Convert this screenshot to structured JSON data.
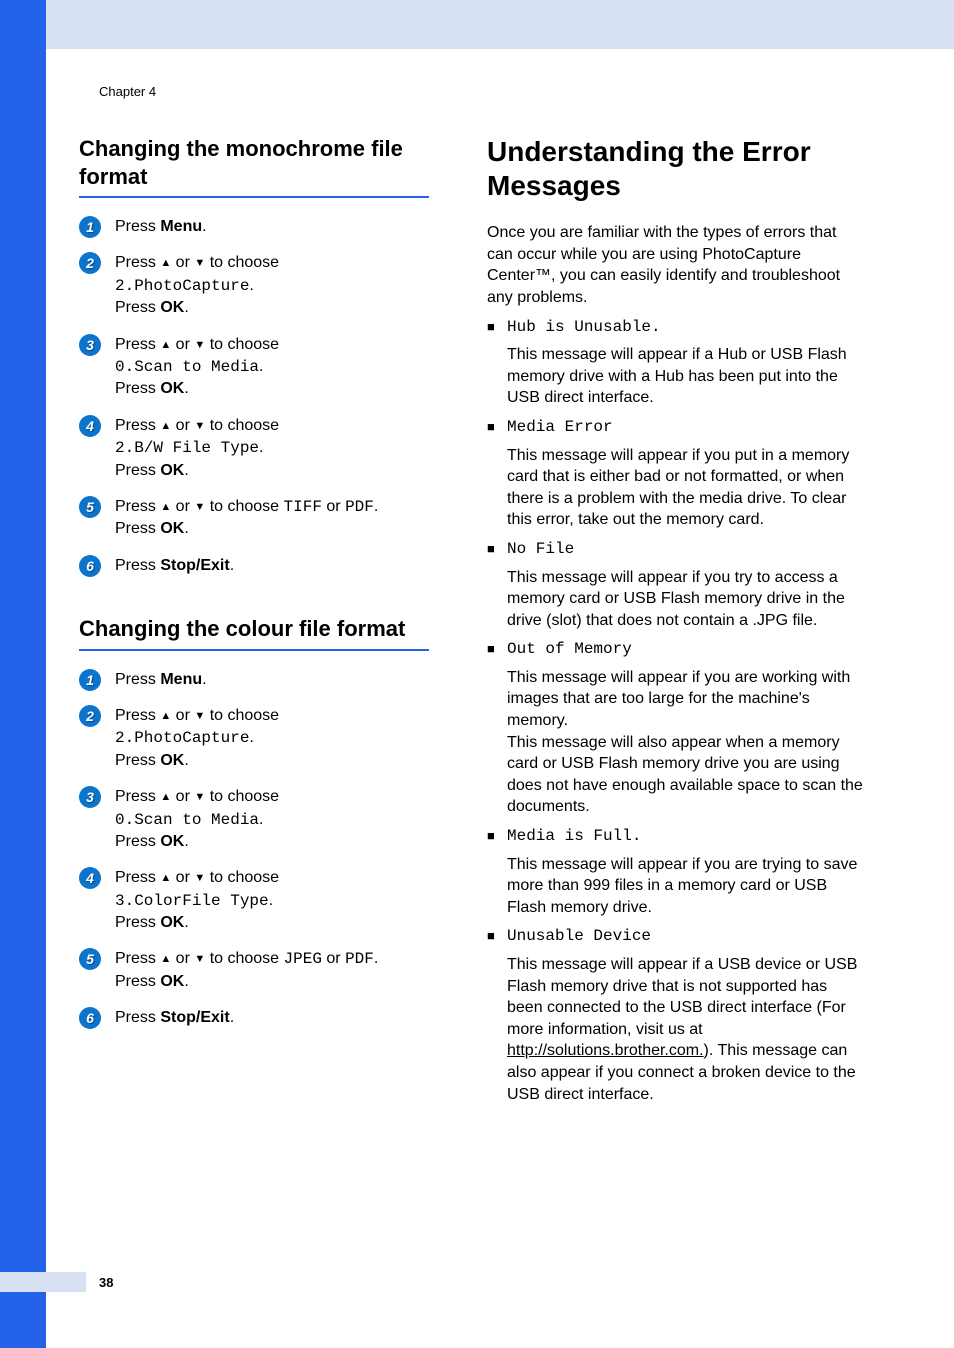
{
  "chapter_label": "Chapter 4",
  "page_number": "38",
  "left": {
    "subtitle_mono": "Changing the monochrome file format",
    "subtitle_colour": "Changing the colour file format",
    "steps_common": {
      "press": "Press ",
      "press_arrows": "Press ▲ or ▼ to choose ",
      "press_ok": "Press ",
      "ok": "OK",
      "dot": ".",
      "menu": "Menu",
      "stopexit": "Stop/Exit",
      "or": " or ",
      "tiff": "TIFF",
      "jpeg": "JPEG",
      "pdf": "PDF"
    },
    "mono_menu_items": {
      "photo": "2.PhotoCapture",
      "scan": "0.Scan to Media",
      "bw": "2.B/W File Type"
    },
    "colour_menu_items": {
      "photo": "2.PhotoCapture",
      "scan": "0.Scan to Media",
      "colour": "3.ColorFile Type"
    }
  },
  "right": {
    "title": "Understanding the Error Messages",
    "intro": "Once you are familiar with the types of errors that can occur while you are using PhotoCapture Center™, you can easily identify and troubleshoot any problems.",
    "errors": [
      {
        "label": "Hub is Unusable.",
        "desc_parts": [
          {
            "t": "This message will appear if a Hub or USB Flash memory drive with a Hub has been put into the USB direct interface."
          }
        ]
      },
      {
        "label": "Media Error",
        "desc_parts": [
          {
            "t": "This message will appear if you put in a memory card that is either bad or not formatted, or when there is a problem with the media drive. To clear this error, take out the memory card."
          }
        ]
      },
      {
        "label": "No File",
        "desc_parts": [
          {
            "t": "This message will appear if you try to access a memory card or USB Flash memory drive in the drive (slot) that does not contain a .JPG file."
          }
        ]
      },
      {
        "label": "Out of Memory",
        "desc_parts": [
          {
            "t": "This message will appear if you are working with images that are too large for the machine's memory."
          },
          {
            "br": true
          },
          {
            "t": "This message will also appear when a memory card or USB Flash memory drive you are using does not have enough available space to scan the documents."
          }
        ]
      },
      {
        "label": "Media is Full.",
        "desc_parts": [
          {
            "t": "This message will appear if you are trying to save more than 999 files in a memory card or USB Flash memory drive."
          }
        ]
      },
      {
        "label": "Unusable Device",
        "desc_parts": [
          {
            "t": "This message will appear if a USB device or USB Flash memory drive that is not supported has been connected to the USB direct interface (For more information, visit us at "
          },
          {
            "t": "http://solutions.brother.com.",
            "u": true
          },
          {
            "t": "). This message can also appear if you connect a broken device to the USB direct interface."
          }
        ]
      }
    ]
  }
}
